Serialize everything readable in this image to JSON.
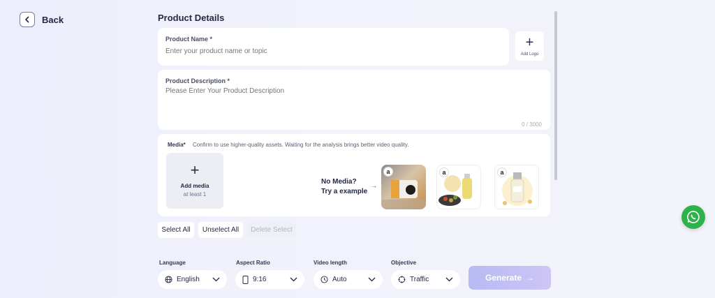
{
  "nav": {
    "back_label": "Back"
  },
  "section_title": "Product Details",
  "product_name": {
    "label": "Product Name *",
    "placeholder": "Enter your product name or topic",
    "value": ""
  },
  "add_logo": {
    "label": "Add Logo"
  },
  "product_description": {
    "label": "Product Description *",
    "placeholder": "Please Enter Your Product Description",
    "value": "",
    "counter": "0 / 3000"
  },
  "media": {
    "label": "Media*",
    "hint": "Confirm to use higher-quality assets. Waiting for the analysis brings better video quality.",
    "add_title": "Add media",
    "add_sub": "at least 1",
    "no_media_line1": "No Media?",
    "no_media_line2": "Try a example",
    "arrow": "→",
    "examples": [
      {
        "badge": "a",
        "icon": "projector-thumbnail"
      },
      {
        "badge": "a",
        "icon": "oil-sprayer-thumbnail"
      },
      {
        "badge": "a",
        "icon": "serum-bottle-thumbnail"
      }
    ]
  },
  "selection": {
    "select_all": "Select All",
    "unselect_all": "Unselect All",
    "delete_select": "Delete Select"
  },
  "options": {
    "language": {
      "label": "Language",
      "value": "English"
    },
    "aspect_ratio": {
      "label": "Aspect Ratio",
      "value": "9:16"
    },
    "video_length": {
      "label": "Video length",
      "value": "Auto"
    },
    "objective": {
      "label": "Objective",
      "value": "Traffic"
    }
  },
  "generate": {
    "label": "Generate",
    "arrow": "→"
  },
  "colors": {
    "accent": "#5a4de6",
    "generate_start": "#b8b9f4",
    "whatsapp": "#2fb24c"
  }
}
